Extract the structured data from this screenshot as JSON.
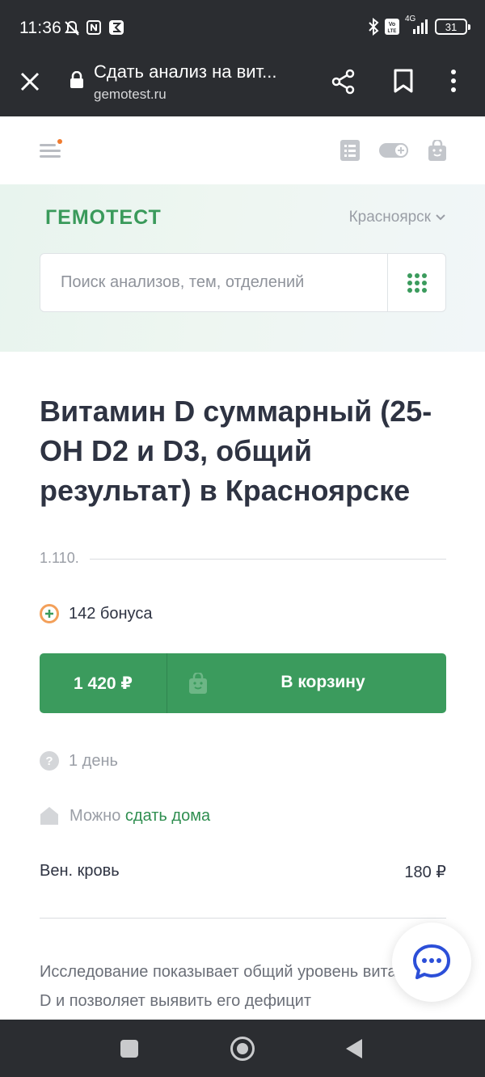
{
  "status_bar": {
    "time": "11:36",
    "network": "4G",
    "volte": "VoLTE",
    "battery": "31"
  },
  "browser": {
    "title": "Сдать анализ на вит...",
    "url": "gemotest.ru",
    "icons": [
      "close-icon",
      "lock-icon",
      "share-icon",
      "bookmark-icon",
      "more-icon"
    ]
  },
  "site_header": {
    "icons": [
      "menu-icon",
      "list-icon",
      "toggle-icon",
      "bag-icon"
    ],
    "notification_dot_color": "#f07b2f"
  },
  "hero": {
    "logo": "ГЕМОТЕСТ",
    "city": "Красноярск",
    "search_placeholder": "Поиск анализов, тем, отделений"
  },
  "product": {
    "title": "Витамин D суммарный (25-OH D2 и D3, общий результат) в Красноярске",
    "code": "1.110.",
    "bonus": "142 бонуса",
    "price": "1 420 ₽",
    "cart_label": "В корзину",
    "duration": "1 день",
    "home_prefix": "Можно",
    "home_link": "сдать дома",
    "sample_label": "Вен. кровь",
    "sample_price": "180 ₽",
    "description": "Исследование показывает общий уровень витамина D и позволяет выявить его дефицит"
  },
  "colors": {
    "brand_green": "#3b9b5d",
    "link_green": "#2f8e50",
    "bonus_orange": "#f3a05a",
    "chat_blue": "#2c4fd8"
  }
}
